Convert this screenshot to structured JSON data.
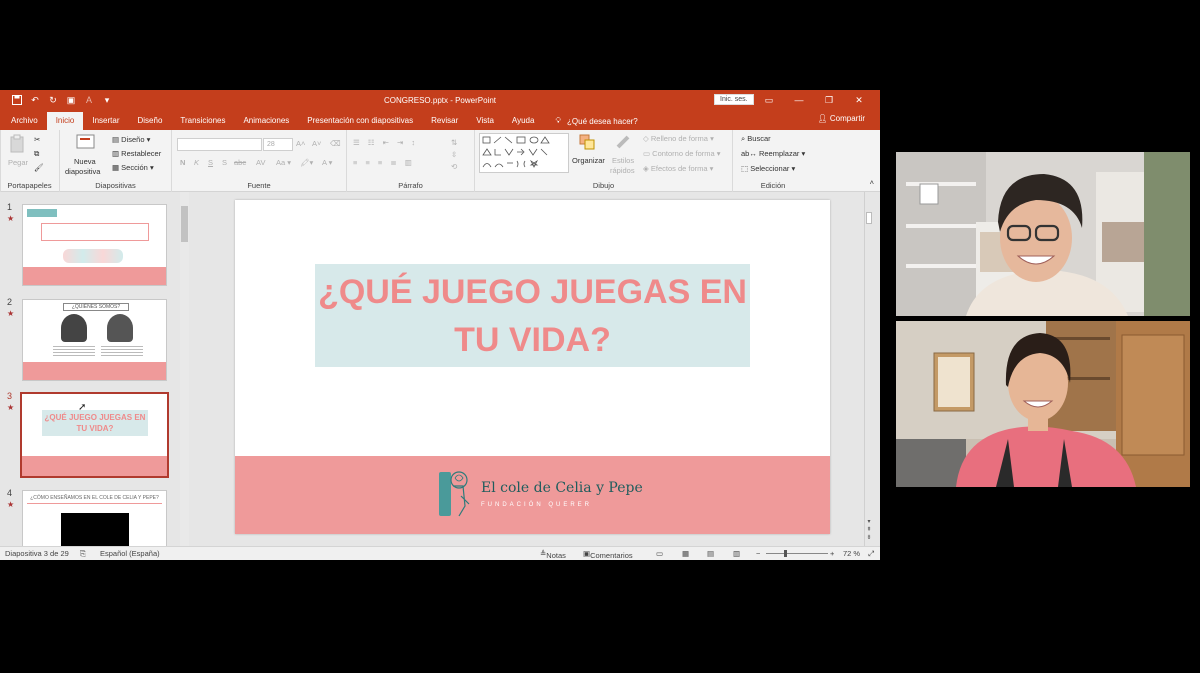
{
  "window": {
    "title": "CONGRESO.pptx  -  PowerPoint",
    "signin_label": "Inic. ses.",
    "share_label": "Compartir",
    "search_label": "¿Qué desea hacer?"
  },
  "tabs": [
    "Archivo",
    "Inicio",
    "Insertar",
    "Diseño",
    "Transiciones",
    "Animaciones",
    "Presentación con diapositivas",
    "Revisar",
    "Vista",
    "Ayuda"
  ],
  "ribbon": {
    "portapapeles": {
      "label": "Portapapeles",
      "paste": "Pegar"
    },
    "diapositivas": {
      "label": "Diapositivas",
      "new_slide_1": "Nueva",
      "new_slide_2": "diapositiva",
      "layout": "Diseño",
      "reset": "Restablecer",
      "section": "Sección"
    },
    "fuente": {
      "label": "Fuente",
      "size": "28",
      "bold": "N",
      "italic": "K",
      "underline": "S",
      "strike": "S",
      "shadow": "abc",
      "spacing": "AV"
    },
    "parrafo": {
      "label": "Párrafo"
    },
    "dibujo": {
      "label": "Dibujo",
      "arrange": "Organizar",
      "styles_1": "Estilos",
      "styles_2": "rápidos",
      "fill": "Relleno de forma",
      "outline": "Contorno de forma",
      "effects": "Efectos de forma"
    },
    "edicion": {
      "label": "Edición",
      "find": "Buscar",
      "replace": "Reemplazar",
      "select": "Seleccionar"
    }
  },
  "thumbnails": [
    {
      "num": "1",
      "star": "★"
    },
    {
      "num": "2",
      "star": "★",
      "heading": "¿QUIÉNES SOMOS?"
    },
    {
      "num": "3",
      "star": "★",
      "line1": "¿QUÉ JUEGO JUEGAS EN",
      "line2": "TU VIDA?"
    },
    {
      "num": "4",
      "star": "★",
      "heading": "¿CÓMO ENSEÑAMOS EN EL COLE DE CELIA Y PEPE?"
    }
  ],
  "slide": {
    "title_line1": "¿QUÉ JUEGO JUEGAS EN",
    "title_line2": "TU VIDA?",
    "logo_title": "El cole de Celia y Pepe",
    "logo_sub": "FUNDACIÓN QUERER"
  },
  "status": {
    "slide_count": "Diapositiva 3 de 29",
    "language": "Español (España)",
    "notes": "Notas",
    "comments": "Comentarios",
    "zoom": "72 %"
  },
  "colors": {
    "accent": "#c43e1c",
    "slide_pink": "#ef9a9a",
    "title_pink": "#ef8a8a",
    "title_bg": "#d7e9ea",
    "logo_teal": "#1f5d5d"
  }
}
